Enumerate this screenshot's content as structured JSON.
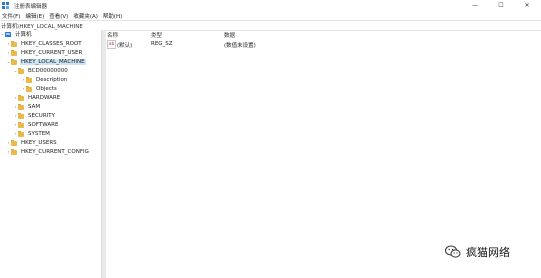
{
  "window": {
    "title": "注册表编辑器",
    "minimize_glyph": "—",
    "maximize_glyph": "☐",
    "close_glyph": "✕"
  },
  "menu": [
    "文件(F)",
    "编辑(E)",
    "查看(V)",
    "收藏夹(A)",
    "帮助(H)"
  ],
  "address": "计算机\\HKEY_LOCAL_MACHINE",
  "tree": {
    "root": "计算机",
    "nodes": [
      {
        "label": "HKEY_CLASSES_ROOT",
        "chevron": "›"
      },
      {
        "label": "HKEY_CURRENT_USER",
        "chevron": "›"
      },
      {
        "label": "HKEY_LOCAL_MACHINE",
        "chevron": "⌄",
        "selected": true
      },
      {
        "label": "BCD00000000",
        "chevron": "⌄"
      },
      {
        "label": "Description",
        "chevron": "›"
      },
      {
        "label": "Objects",
        "chevron": "›"
      },
      {
        "label": "HARDWARE",
        "chevron": "›"
      },
      {
        "label": "SAM",
        "chevron": "›"
      },
      {
        "label": "SECURITY",
        "chevron": "›"
      },
      {
        "label": "SOFTWARE",
        "chevron": "›"
      },
      {
        "label": "SYSTEM",
        "chevron": "›"
      },
      {
        "label": "HKEY_USERS",
        "chevron": "›"
      },
      {
        "label": "HKEY_CURRENT_CONFIG",
        "chevron": "›"
      }
    ]
  },
  "list": {
    "columns": [
      "名称",
      "类型",
      "数据"
    ],
    "rows": [
      {
        "icon": "ab",
        "name": "(默认)",
        "type": "REG_SZ",
        "data": "(数值未设置)"
      }
    ]
  },
  "watermark": "疯猫网络",
  "colors": {
    "selection": "#cce4f7",
    "folder": "#e9b94a",
    "accent": "#2b79d6"
  }
}
